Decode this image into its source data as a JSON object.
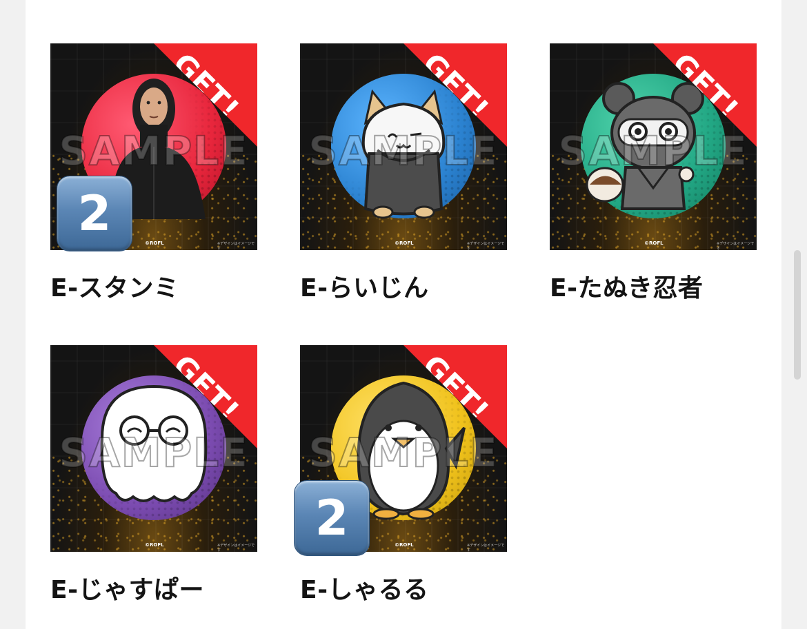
{
  "items": [
    {
      "name": "E-スタンミ",
      "badge_color": "#e8263c",
      "count": "2",
      "ribbon": "GET!",
      "watermark": "SAMPLE",
      "copyright": "©ROFL",
      "note": "※デザインはイメージです"
    },
    {
      "name": "E-らいじん",
      "badge_color": "#2b82d0",
      "count": null,
      "ribbon": "GET!",
      "watermark": "SAMPLE",
      "copyright": "©ROFL",
      "note": "※デザインはイメージです"
    },
    {
      "name": "E-たぬき忍者",
      "badge_color": "#22a784",
      "count": null,
      "ribbon": "GET!",
      "watermark": "SAMPLE",
      "copyright": "©ROFL",
      "note": "※デザインはイメージです"
    },
    {
      "name": "E-じゃすぱー",
      "badge_color": "#7b4bb0",
      "count": null,
      "ribbon": "GET!",
      "watermark": "SAMPLE",
      "copyright": "©ROFL",
      "note": "※デザインはイメージです"
    },
    {
      "name": "E-しゃるる",
      "badge_color": "#f0c21c",
      "count": "2",
      "ribbon": "GET!",
      "watermark": "SAMPLE",
      "copyright": "©ROFL",
      "note": "※デザインはイメージです"
    }
  ],
  "icons": {
    "count_badge": "keycap-digit-two-icon",
    "ribbon": "get-ribbon-icon"
  }
}
